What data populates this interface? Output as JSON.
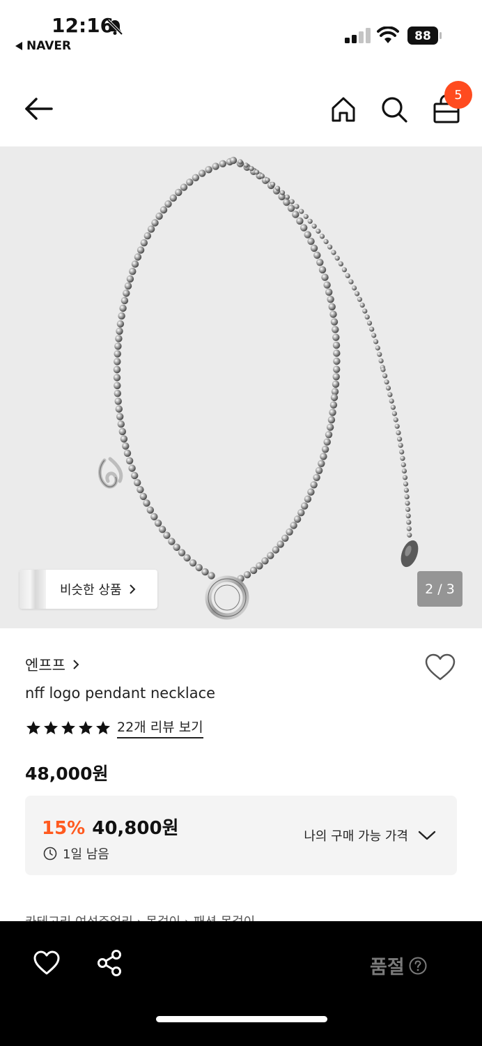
{
  "status_bar": {
    "time": "12:16",
    "back_app": "NAVER",
    "battery": "88"
  },
  "header": {
    "cart_count": "5"
  },
  "gallery": {
    "similar_label": "비슷한 상품",
    "counter": "2 / 3"
  },
  "product": {
    "brand": "엔프프",
    "name": "nff logo pendant necklace",
    "rating_stars": 5,
    "review_link": "22개 리뷰 보기",
    "price": "48,000원",
    "discount_pct": "15%",
    "sale_price": "40,800원",
    "time_left": "1일 남음",
    "my_price_label": "나의 구매 가능 가격",
    "category_partial": "카테고리         여성주얼리 › 목걸이 › 패션 목걸이"
  },
  "bottom_bar": {
    "soldout": "품절"
  },
  "colors": {
    "accent": "#ff4b1f",
    "discount": "#ff5a1f",
    "image_bg": "#ebebeb",
    "price_box_bg": "#f4f4f4"
  }
}
